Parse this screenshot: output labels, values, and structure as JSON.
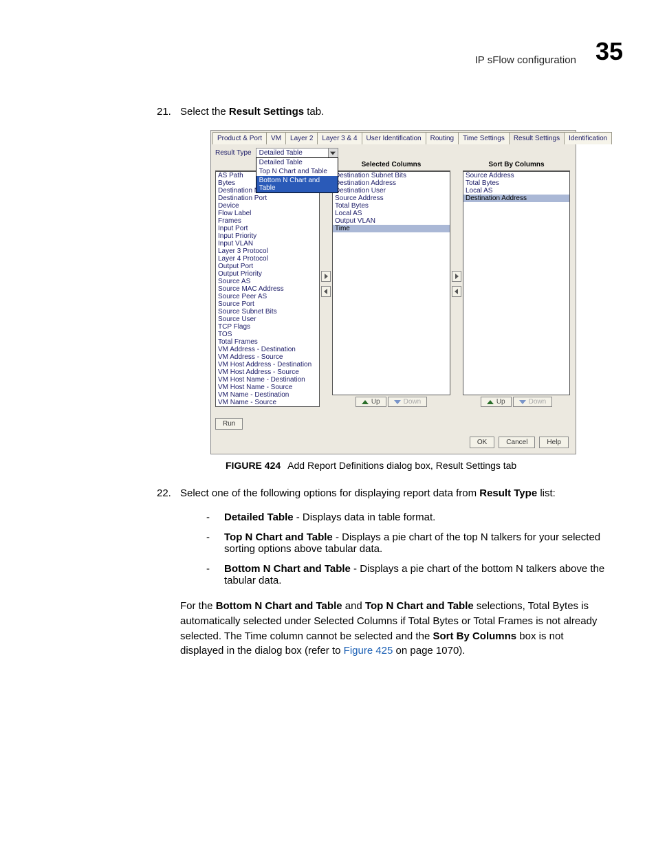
{
  "header": {
    "section": "IP sFlow configuration",
    "chapter": "35"
  },
  "steps": {
    "s21num": "21.",
    "s21a": "Select the ",
    "s21b": "Result Settings",
    "s21c": " tab.",
    "s22num": "22.",
    "s22a": "Select one of the following options for displaying report data from ",
    "s22b": "Result Type",
    "s22c": " list:"
  },
  "figure": {
    "label": "FIGURE 424",
    "caption": "Add Report Definitions dialog box, Result Settings tab"
  },
  "bullets": {
    "b1a": "Detailed Table",
    "b1b": " - Displays data in table format.",
    "b2a": "Top N Chart and Table",
    "b2b": " - Displays a pie chart of the top N talkers for your selected sorting options above tabular data.",
    "b3a": "Bottom N Chart and Table",
    "b3b": " - Displays a pie chart of the bottom N talkers above the tabular data."
  },
  "para": {
    "p1": "For the ",
    "p2": "Bottom N Chart and Table",
    "p3": " and ",
    "p4": "Top N Chart and Table",
    "p5": " selections, Total Bytes is automatically selected under Selected Columns if Total Bytes or Total Frames is not already selected. The Time column cannot be selected and the ",
    "p6": "Sort By Columns",
    "p7": " box is not displayed in the dialog box (refer to ",
    "p8": "Figure 425",
    "p9": " on page 1070)."
  },
  "dlg": {
    "tabs": [
      "Product & Port",
      "VM",
      "Layer 2",
      "Layer 3 & 4",
      "User Identification",
      "Routing",
      "Time Settings",
      "Result Settings",
      "Identification"
    ],
    "resultTypeLabel": "Result Type",
    "resultTypeValue": "Detailed Table",
    "resultTypeOptions": [
      "Detailed Table",
      "Top N Chart and Table",
      "Bottom N Chart and Table"
    ],
    "dropdownSel": 2,
    "hdrSelected": "Selected Columns",
    "hdrSort": "Sort By Columns",
    "available": [
      "AS Path",
      "Bytes",
      "Destination MAC Address",
      "Destination Port",
      "Device",
      "Flow Label",
      "Frames",
      "Input Port",
      "Input Priority",
      "Input VLAN",
      "Layer 3 Protocol",
      "Layer 4 Protocol",
      "Output Port",
      "Output Priority",
      "Source AS",
      "Source MAC Address",
      "Source Peer AS",
      "Source Port",
      "Source Subnet Bits",
      "Source User",
      "TCP Flags",
      "TOS",
      "Total Frames",
      "VM Address - Destination",
      "VM Address - Source",
      "VM Host Address - Destination",
      "VM Host Address - Source",
      "VM Host Name - Destination",
      "VM Host Name - Source",
      "VM Name - Destination",
      "VM Name - Source"
    ],
    "selected": [
      "Destination Subnet Bits",
      "Destination Address",
      "Destination User",
      "Source Address",
      "Total Bytes",
      "Local AS",
      "Output VLAN",
      "Time"
    ],
    "selectedHL": 7,
    "sort": [
      "Source Address",
      "Total Bytes",
      "Local AS",
      "Destination Address"
    ],
    "sortHL": 3,
    "btnUp": "Up",
    "btnDown": "Down",
    "btnRun": "Run",
    "btnOK": "OK",
    "btnCancel": "Cancel",
    "btnHelp": "Help"
  }
}
